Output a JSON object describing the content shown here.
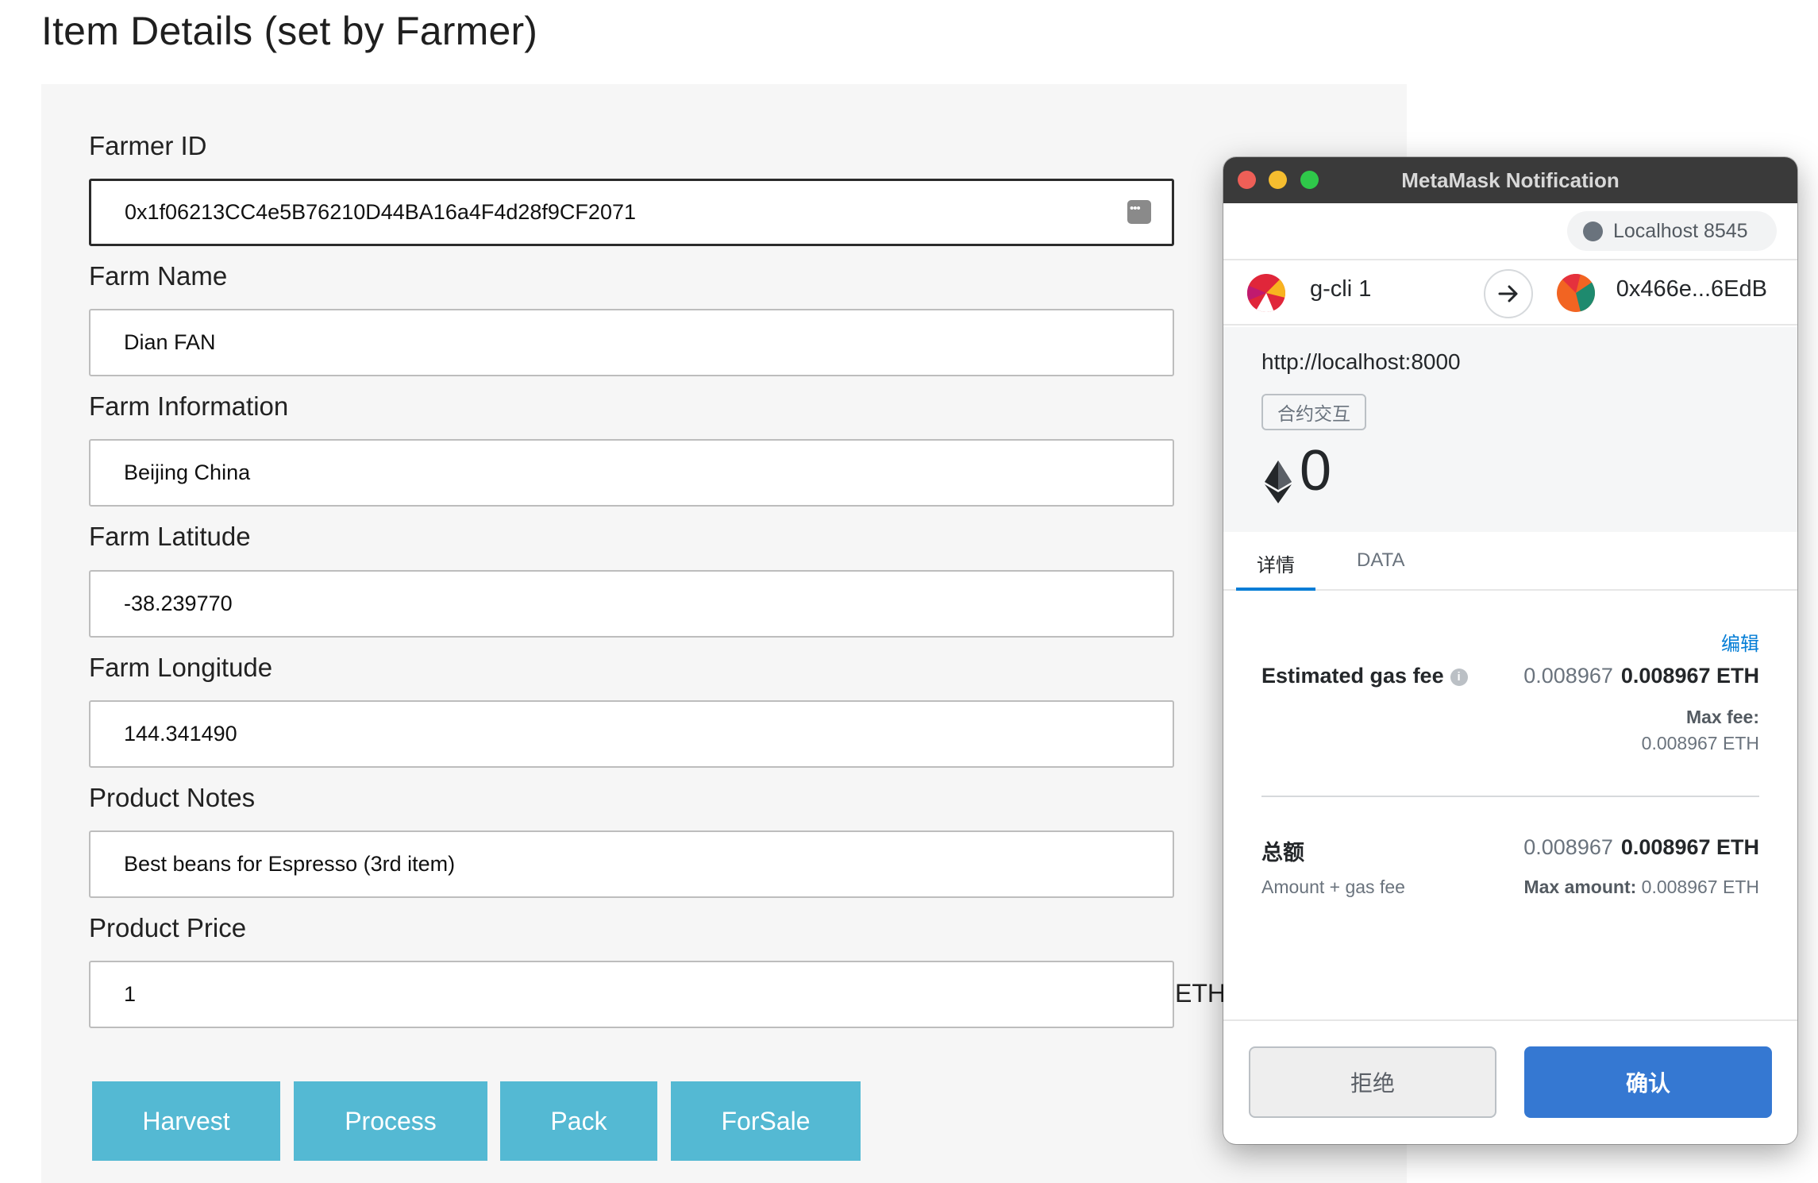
{
  "page": {
    "title": "Item Details (set by Farmer)"
  },
  "form": {
    "fields": [
      {
        "label": "Farmer ID",
        "value": "0x1f06213CC4e5B76210D44BA16a4F4d28f9CF2071"
      },
      {
        "label": "Farm Name",
        "value": "Dian FAN"
      },
      {
        "label": "Farm Information",
        "value": "Beijing China"
      },
      {
        "label": "Farm Latitude",
        "value": "-38.239770"
      },
      {
        "label": "Farm Longitude",
        "value": "144.341490"
      },
      {
        "label": "Product Notes",
        "value": "Best beans for Espresso (3rd item)"
      },
      {
        "label": "Product Price",
        "value": "1"
      }
    ],
    "price_unit": "ETH",
    "buttons": [
      "Harvest",
      "Process",
      "Pack",
      "ForSale"
    ],
    "button_color": "#54b9d3"
  },
  "metamask": {
    "window_title": "MetaMask Notification",
    "network": "Localhost 8545",
    "from_account": "g-cli 1",
    "to_account": "0x466e...6EdB",
    "origin": "http://localhost:8000",
    "tx_type": "合约交互",
    "amount": "0",
    "tabs": [
      "详情",
      "DATA"
    ],
    "edit_label": "编辑",
    "gas": {
      "label": "Estimated gas fee",
      "value_light": "0.008967",
      "value_bold": "0.008967 ETH",
      "max_fee_label": "Max fee:",
      "max_fee_value": "0.008967 ETH"
    },
    "total": {
      "label": "总额",
      "value_light": "0.008967",
      "value_bold": "0.008967 ETH",
      "sub_label": "Amount + gas fee",
      "max_amount_label": "Max amount:",
      "max_amount_value": "0.008967 ETH"
    },
    "reject_label": "拒绝",
    "confirm_label": "确认",
    "accent_color": "#037dd6"
  }
}
